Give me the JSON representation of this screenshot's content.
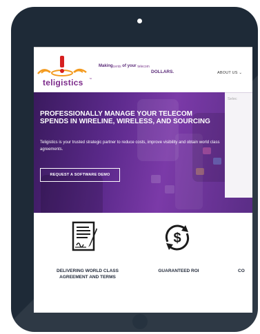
{
  "brand": {
    "logo_text": "teligistics",
    "tagline_a": "Making",
    "tagline_b": "cents",
    "tagline_c": "of your",
    "tagline_d": "telecom",
    "tagline_e": "DOLLARS."
  },
  "nav": {
    "about_label": "ABOUT US",
    "about_caret": "⌄"
  },
  "hero": {
    "title": "PROFESSIONALLY MANAGE YOUR TELECOM SPENDS IN WIRELINE, WIRELESS, AND SOURCING",
    "subtitle": "Teligistics is your trusted strategic partner to reduce costs, improve visibility and obtain world class agreements.",
    "cta_label": "REQUEST A SOFTWARE DEMO",
    "panel_text": "Selec"
  },
  "features": [
    {
      "line1": "DELIVERING WORLD CLASS",
      "line2": "AGREEMENT AND TERMS",
      "icon": "contract-signature-icon"
    },
    {
      "line1": "GUARANTEED ROI",
      "line2": "",
      "icon": "dollar-cycle-icon"
    },
    {
      "line1": "CO",
      "line2": "",
      "icon": ""
    }
  ],
  "colors": {
    "device": "#1e2a37",
    "brand_purple": "#7b2a8a",
    "hero_purple": "#5c2a8c",
    "logo_orange": "#f39a1e",
    "logo_red": "#d61f1f"
  }
}
